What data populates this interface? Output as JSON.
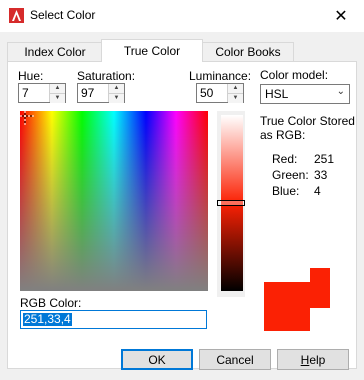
{
  "window": {
    "title": "Select Color",
    "close_glyph": "✕",
    "app_icon": "autocad-logo-icon",
    "icon_color": "#d62b2b"
  },
  "tabs": [
    {
      "label": "Index Color",
      "active": false
    },
    {
      "label": "True Color",
      "active": true
    },
    {
      "label": "Color Books",
      "active": false
    }
  ],
  "hsl": {
    "hue_label": "Hue:",
    "hue_value": "7",
    "saturation_label": "Saturation:",
    "saturation_value": "97",
    "luminance_label": "Luminance:",
    "luminance_value": "50",
    "luminance_level": 0.5
  },
  "color_model": {
    "label": "Color model:",
    "value": "HSL"
  },
  "stored": {
    "heading_line1": "True Color Stored",
    "heading_line2": "as RGB:",
    "red_label": "Red:",
    "red_value": "251",
    "green_label": "Green:",
    "green_value": "33",
    "blue_label": "Blue:",
    "blue_value": "4"
  },
  "rgb_color": {
    "label": "RGB Color:",
    "value": "251,33,4"
  },
  "swatch_color": "#fb2104",
  "buttons": {
    "ok": "OK",
    "cancel": "Cancel",
    "help": "Help"
  },
  "colors": {
    "accent": "#0078d7"
  }
}
